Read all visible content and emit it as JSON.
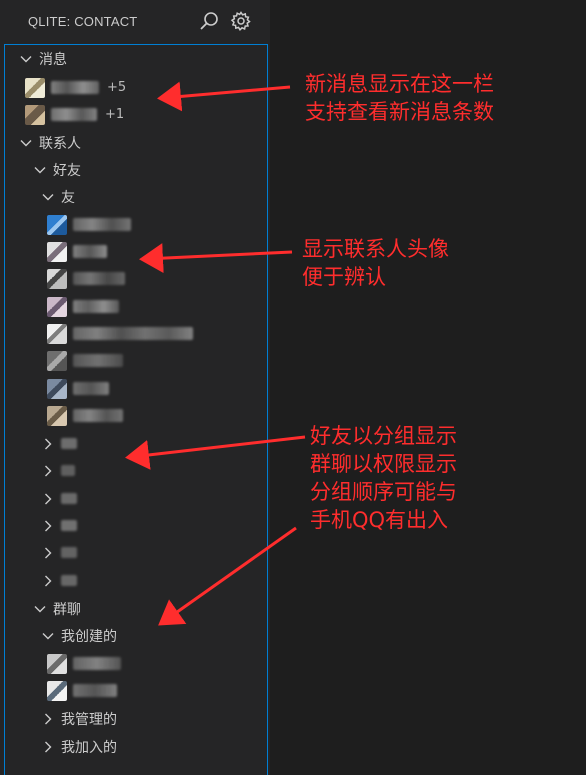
{
  "panel": {
    "title": "QLITE: CONTACT"
  },
  "tree": {
    "messages": {
      "label": "消息",
      "items": [
        {
          "count": "+5"
        },
        {
          "count": "+1"
        }
      ]
    },
    "contacts": {
      "label": "联系人",
      "friends": {
        "label": "好友",
        "group": {
          "label": "友",
          "count_of_contacts": 8
        },
        "collapsed_groups_count": 6
      },
      "groups": {
        "label": "群聊",
        "created": {
          "label": "我创建的"
        },
        "managed": {
          "label": "我管理的"
        },
        "joined": {
          "label": "我加入的"
        }
      }
    }
  },
  "annotations": {
    "messages_note": [
      "新消息显示在这一栏",
      "支持查看新消息条数"
    ],
    "avatar_note": [
      "显示联系人头像",
      "便于辨认"
    ],
    "grouping_note": [
      "好友以分组显示",
      "群聊以权限显示",
      "分组顺序可能与",
      "手机QQ有出入"
    ]
  },
  "colors": {
    "annotation": "#ff2d2d",
    "focus_border": "#007fd4",
    "panel_bg": "#252526",
    "editor_bg": "#1e1e1e"
  }
}
